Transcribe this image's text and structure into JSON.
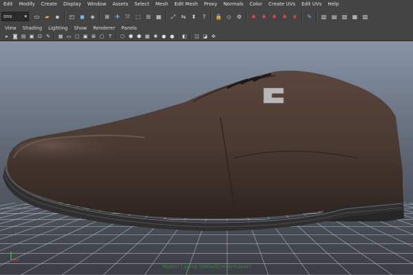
{
  "menubar": {
    "items": [
      "Edit",
      "Modify",
      "Create",
      "Display",
      "Window",
      "Assets",
      "Select",
      "Mesh",
      "Edit Mesh",
      "Proxy",
      "Normals",
      "Color",
      "Create UVs",
      "Edit UVs",
      "Help"
    ]
  },
  "toolbar": {
    "mode_value": "ons",
    "icons": [
      {
        "name": "new-scene-icon",
        "glyph": "▭",
        "color": "#e8e8e8"
      },
      {
        "name": "open-scene-icon",
        "glyph": "▰",
        "color": "#d8a94a"
      },
      {
        "name": "save-scene-icon",
        "glyph": "▪",
        "color": "#cfcfcf"
      },
      {
        "name": "sep",
        "glyph": "",
        "color": ""
      },
      {
        "name": "select-by-hierarchy-icon",
        "glyph": "◰",
        "color": "#ddd"
      },
      {
        "name": "select-by-object-icon",
        "glyph": "◼",
        "color": "#6fb7e8"
      },
      {
        "name": "select-by-component-icon",
        "glyph": "◈",
        "color": "#ddd"
      },
      {
        "name": "sep",
        "glyph": "",
        "color": ""
      },
      {
        "name": "snap-grid-icon",
        "glyph": "⊞",
        "color": "#ddd"
      },
      {
        "name": "snap-curve-icon",
        "glyph": "✛",
        "color": "#9ed0ff"
      },
      {
        "name": "snap-point-icon",
        "glyph": "⤧",
        "color": "#ddd"
      },
      {
        "name": "snap-view-plane-icon",
        "glyph": "⬚",
        "color": "#ddd"
      },
      {
        "name": "make-live-icon",
        "glyph": "⊟",
        "color": "#ddd"
      },
      {
        "name": "history-icon",
        "glyph": "▦",
        "color": "#ddd"
      },
      {
        "name": "sep",
        "glyph": "",
        "color": ""
      },
      {
        "name": "input-ops-icon",
        "glyph": "⤢",
        "color": "#ddd"
      },
      {
        "name": "output-ops-icon",
        "glyph": "⇆",
        "color": "#ddd"
      },
      {
        "name": "construction-history-icon",
        "glyph": "⬍",
        "color": "#ddd"
      },
      {
        "name": "help-line-icon",
        "glyph": "?",
        "color": "#ddd"
      },
      {
        "name": "sep",
        "glyph": "",
        "color": ""
      },
      {
        "name": "render-current-frame-icon",
        "glyph": "🔒",
        "color": "#e0c84a"
      },
      {
        "name": "render-region-icon",
        "glyph": "◇",
        "color": "#ddd"
      },
      {
        "name": "ipr-render-icon",
        "glyph": "⚙",
        "color": "#ddd"
      },
      {
        "name": "sep",
        "glyph": "",
        "color": ""
      },
      {
        "name": "render-settings-icon",
        "glyph": "♣",
        "color": "#e04a4a"
      },
      {
        "name": "hypershade-icon",
        "glyph": "♣",
        "color": "#e04a4a"
      },
      {
        "name": "render-view-icon",
        "glyph": "♣",
        "color": "#e04a4a"
      },
      {
        "name": "render-layer-icon",
        "glyph": "♣",
        "color": "#e04a4a"
      },
      {
        "name": "render-globals-icon",
        "glyph": "❦",
        "color": "#e04a4a"
      },
      {
        "name": "sep",
        "glyph": "",
        "color": ""
      },
      {
        "name": "attribute-editor-icon",
        "glyph": "✎",
        "color": "#4fd5d5"
      },
      {
        "name": "sep",
        "glyph": "",
        "color": ""
      },
      {
        "name": "outliner-icon",
        "glyph": "▥",
        "color": "#ddd"
      },
      {
        "name": "channel-box-icon",
        "glyph": "▤",
        "color": "#ddd"
      },
      {
        "name": "tool-settings-icon",
        "glyph": "▧",
        "color": "#ddd"
      },
      {
        "name": "layer-editor-icon",
        "glyph": "▦",
        "color": "#ddd"
      },
      {
        "name": "modeling-toolkit-icon",
        "glyph": "▨",
        "color": "#ddd"
      }
    ]
  },
  "panel_menu": {
    "items": [
      "View",
      "Shading",
      "Lighting",
      "Show",
      "Renderer",
      "Panels"
    ]
  },
  "panel_toolbar": {
    "icons": [
      {
        "name": "camera-select-icon",
        "glyph": "▸"
      },
      {
        "name": "camera-attributes-icon",
        "glyph": "◙"
      },
      {
        "name": "bookmarks-icon",
        "glyph": "▤"
      },
      {
        "name": "image-plane-icon",
        "glyph": "▣"
      },
      {
        "name": "two-d-pan-zoom-icon",
        "glyph": "⊡"
      },
      {
        "name": "grease-pencil-icon",
        "glyph": "✎"
      },
      {
        "name": "sep",
        "glyph": ""
      },
      {
        "name": "grid-toggle-icon",
        "glyph": "▦"
      },
      {
        "name": "film-gate-icon",
        "glyph": "▭"
      },
      {
        "name": "resolution-gate-icon",
        "glyph": "▢"
      },
      {
        "name": "gate-mask-icon",
        "glyph": "▣"
      },
      {
        "name": "field-chart-icon",
        "glyph": "⊠"
      },
      {
        "name": "safe-action-icon",
        "glyph": "▢"
      },
      {
        "name": "safe-title-icon",
        "glyph": "T"
      },
      {
        "name": "sep",
        "glyph": ""
      },
      {
        "name": "wireframe-icon",
        "glyph": "⬡"
      },
      {
        "name": "smooth-shade-icon",
        "glyph": "⬢"
      },
      {
        "name": "wireframe-on-shaded-icon",
        "glyph": "⬢"
      },
      {
        "name": "textured-icon",
        "glyph": "▦"
      },
      {
        "name": "use-all-lights-icon",
        "glyph": "✺"
      },
      {
        "name": "shadows-icon",
        "glyph": "●"
      },
      {
        "name": "ambient-occlusion-icon",
        "glyph": "●"
      },
      {
        "name": "sep",
        "glyph": ""
      },
      {
        "name": "isolate-select-icon",
        "glyph": "◧"
      },
      {
        "name": "sep",
        "glyph": ""
      },
      {
        "name": "xray-icon",
        "glyph": "◫"
      },
      {
        "name": "xray-joints-icon",
        "glyph": "◪"
      },
      {
        "name": "xray-components-icon",
        "glyph": "✜"
      }
    ]
  },
  "viewport": {
    "camera_label": "Models | persp (default|renderLayer)",
    "axis_gizmo": {
      "x_color": "#d63a3a",
      "y_color": "#3ad63a",
      "z_color": "#3a6ad6"
    },
    "colors": {
      "shoe_upper": "#4a3a32",
      "shoe_sole": "#2b2b2b",
      "grid": "#c8ccd2",
      "logo": "#b8b8b8"
    }
  }
}
